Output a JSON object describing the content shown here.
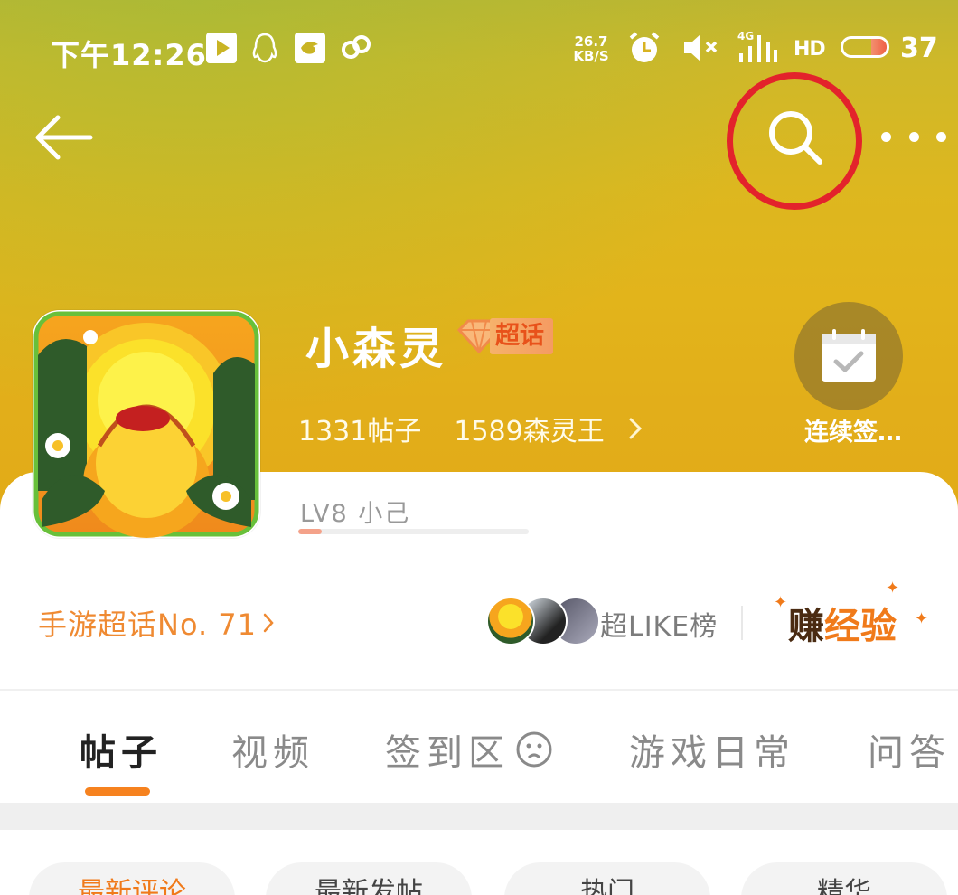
{
  "status_bar": {
    "time": "下午12:26",
    "net_speed_value": "26.7",
    "net_speed_unit": "KB/S",
    "network_type": "4G",
    "hd_label": "HD",
    "battery_percent": "37"
  },
  "header": {
    "topic_name": "小森灵",
    "super_badge_label": "超话",
    "posts_stat": "1331帖子",
    "fans_stat": "1589森灵王",
    "checkin_label": "连续签…"
  },
  "level": {
    "label": "LV8  小己",
    "progress_fraction": 0.1
  },
  "rank": {
    "label": "手游超话No. 71"
  },
  "like_board": {
    "label": "超LIKE榜"
  },
  "earn": {
    "part1": "赚",
    "part2": "经验"
  },
  "tabs": [
    {
      "label": "帖子",
      "active": true
    },
    {
      "label": "视频",
      "active": false
    },
    {
      "label": "签到区",
      "active": false
    },
    {
      "label": "游戏日常",
      "active": false
    },
    {
      "label": "问答",
      "active": false
    }
  ],
  "filters": [
    {
      "label": "最新评论",
      "active": true
    },
    {
      "label": "最新发帖",
      "active": false
    },
    {
      "label": "热门",
      "active": false
    },
    {
      "label": "精华",
      "active": false
    }
  ],
  "colors": {
    "accent_orange": "#f6821f",
    "highlight_red": "#e3232b",
    "header_gold": "#e2b41b"
  }
}
